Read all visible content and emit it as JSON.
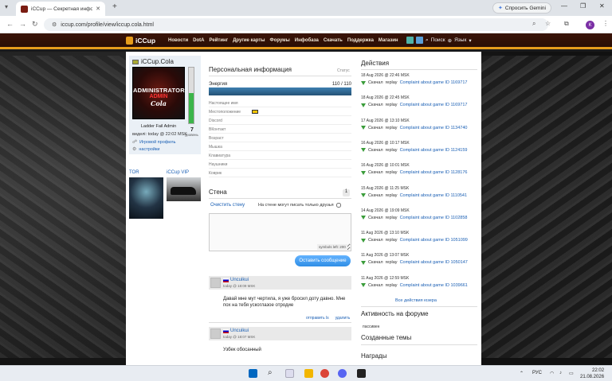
{
  "browser": {
    "tab_title": "iCCup — Секретная информа…",
    "tab_close": "✕",
    "new_tab": "+",
    "url": "iccup.com/profile/view/iccup.cola.html",
    "gemini": "Спросить Gemini",
    "profile_letter": "К",
    "win_min": "—",
    "win_max": "❐",
    "win_close": "✕"
  },
  "site": {
    "logo": "iCCup",
    "nav": [
      "Новости",
      "DotA",
      "Рейтинг",
      "Другие карты",
      "Форумы",
      "Инфобаза",
      "Скачать",
      "Поддержка",
      "Магазин"
    ],
    "search": "Поиск",
    "language": "Язык"
  },
  "profile": {
    "username": "iCCup.Cola",
    "portrait_text": [
      "ADMINISTRATOR",
      "ADMIN",
      "Cola"
    ],
    "level": "7",
    "level_label": "уровень",
    "level_fraction": 0.55,
    "rank": "Ladder Fail Admin",
    "seen": "виделi: today @ 22:02 MSK",
    "links": [
      {
        "icon": "☍",
        "label": "Игровой профиль"
      },
      {
        "icon": "⚙",
        "label": "настройки"
      }
    ],
    "thumbs": [
      "TOR",
      "iCCup VIP"
    ]
  },
  "personal": {
    "title": "Персональная информация",
    "status": "Статус",
    "energy_label": "Энергия",
    "energy_value": "110 / 110",
    "energy_fraction": 1.0,
    "fields": [
      "Настоящее имя",
      "Местоположение",
      "Discord",
      "ВКонтакт",
      "Возраст",
      "Мышка",
      "Клавиатура",
      "Наушники",
      "Коврик"
    ]
  },
  "wall": {
    "title": "Стена",
    "count": "1",
    "clear": "Очистить стену",
    "friends_only": "На стене могут писать только друзья",
    "symbols_left": "symbols left: 200",
    "post_button": "Оставить сообщение",
    "posts": [
      {
        "author": "Uncuikui",
        "time": "today @ 18:09 MSK",
        "text": "Давай мне мут чертила, я уже бросил доту давно. Мне пох на тебя ускоглазое отродие",
        "reply": "отправить ls",
        "delete": "удалить"
      },
      {
        "author": "Uncuikui",
        "time": "today @ 18:07 MSK",
        "text": "Узбек обосанный"
      }
    ]
  },
  "activity": {
    "title": "Действия",
    "items": [
      {
        "date": "18 Aug 2026 @ 22:46 MSK",
        "action": "Скачал",
        "type": "replay",
        "link": "Complaint about game ID 1169717"
      },
      {
        "date": "18 Aug 2026 @ 22:45 MSK",
        "action": "Скачал",
        "type": "replay",
        "link": "Complaint about game ID 1169717"
      },
      {
        "date": "17 Aug 2026 @ 13:10 MSK",
        "action": "Скачал",
        "type": "replay",
        "link": "Complaint about game ID 1134740"
      },
      {
        "date": "16 Aug 2026 @ 10:17 MSK",
        "action": "Скачал",
        "type": "replay",
        "link": "Complaint about game ID 1124159"
      },
      {
        "date": "16 Aug 2026 @ 10:01 MSK",
        "action": "Скачал",
        "type": "replay",
        "link": "Complaint about game ID 1128176"
      },
      {
        "date": "15 Aug 2026 @ 11:25 MSK",
        "action": "Скачал",
        "type": "replay",
        "link": "Complaint about game ID 1110541"
      },
      {
        "date": "14 Aug 2026 @ 19:09 MSK",
        "action": "Скачал",
        "type": "replay",
        "link": "Complaint about game ID 1102858"
      },
      {
        "date": "11 Aug 2026 @ 13:10 MSK",
        "action": "Скачал",
        "type": "replay",
        "link": "Complaint about game ID 1051099"
      },
      {
        "date": "11 Aug 2026 @ 13:07 MSK",
        "action": "Скачал",
        "type": "replay",
        "link": "Complaint about game ID 1050147"
      },
      {
        "date": "11 Aug 2026 @ 12:59 MSK",
        "action": "Скачал",
        "type": "replay",
        "link": "Complaint about game ID 1039661"
      }
    ],
    "all": "Все действия юзера",
    "forum_title": "Активность на форуме",
    "forum_status": "пассивен",
    "topics_title": "Созданные темы",
    "awards_title": "Награды"
  },
  "taskbar": {
    "lang": "РУС",
    "time": "22:02",
    "date": "21.08.2026",
    "colors": {
      "start": "#0067c0",
      "search": "#2b2b2b",
      "files": "#f2b600",
      "chrome": "#db4437",
      "discord": "#5865f2"
    }
  }
}
